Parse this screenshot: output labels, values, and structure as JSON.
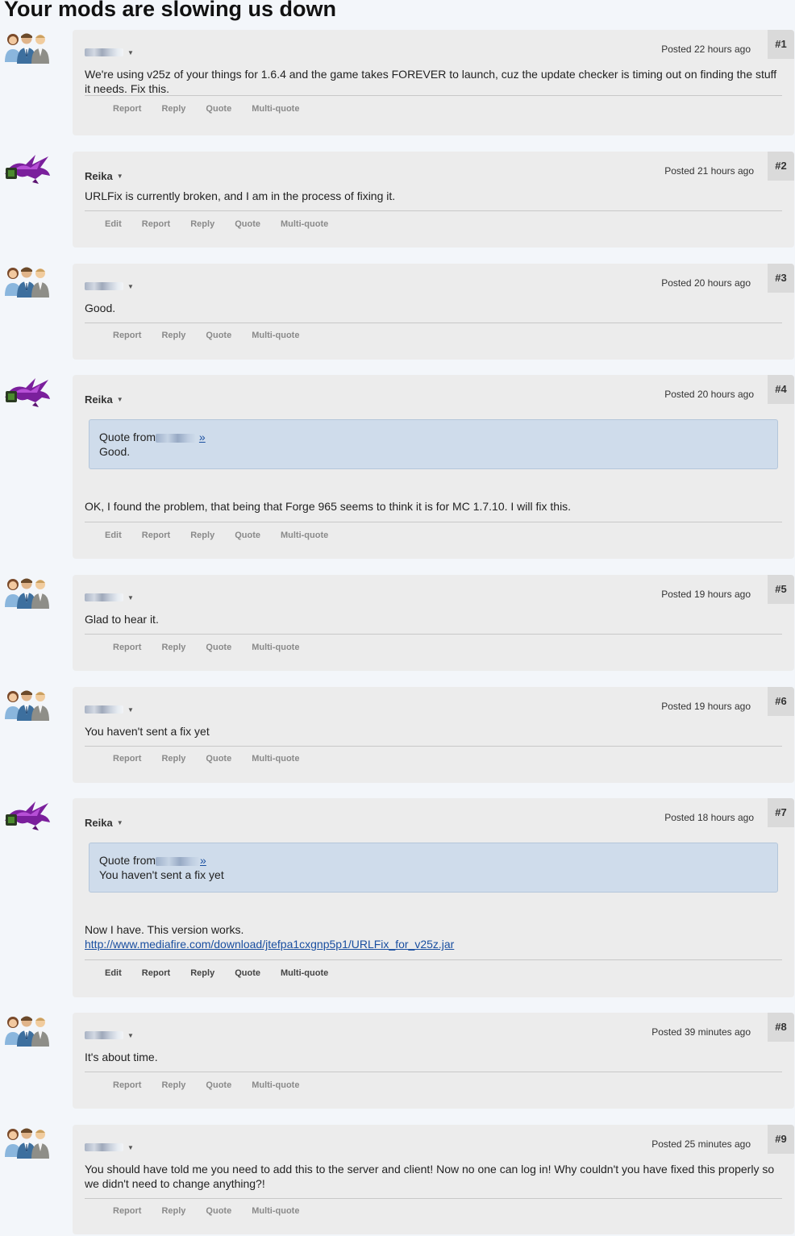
{
  "page_title": "Your mods are slowing us down",
  "actions": {
    "edit": "Edit",
    "report": "Report",
    "reply": "Reply",
    "quote": "Quote",
    "multi_quote": "Multi-quote"
  },
  "quote_prefix": "Quote from",
  "quote_link": "»",
  "posts": [
    {
      "num": "#1",
      "author": "",
      "posted": "Posted 22 hours ago",
      "text": "We're using v25z of your things for 1.6.4 and the game takes FOREVER to launch, cuz the update checker is timing out on finding the stuff it needs. Fix this."
    },
    {
      "num": "#2",
      "author": "Reika",
      "posted": "Posted 21 hours ago",
      "text": "URLFix is currently broken, and I am in the process of fixing it."
    },
    {
      "num": "#3",
      "author": "",
      "posted": "Posted 20 hours ago",
      "text": "Good."
    },
    {
      "num": "#4",
      "author": "Reika",
      "posted": "Posted 20 hours ago",
      "quote_text": "Good.",
      "text": "OK, I found the problem, that being that Forge 965 seems to think it is for MC 1.7.10. I will fix this."
    },
    {
      "num": "#5",
      "author": "",
      "posted": "Posted 19 hours ago",
      "text": "Glad to hear it."
    },
    {
      "num": "#6",
      "author": "",
      "posted": "Posted 19 hours ago",
      "text": "You haven't sent a fix yet"
    },
    {
      "num": "#7",
      "author": "Reika",
      "posted": "Posted 18 hours ago",
      "quote_text": "You haven't sent a fix yet",
      "text": "Now I have. This version works.",
      "link": "http://www.mediafire.com/download/jtefpa1cxgnp5p1/URLFix_for_v25z.jar"
    },
    {
      "num": "#8",
      "author": "",
      "posted": "Posted 39 minutes ago",
      "text": "It's about time."
    },
    {
      "num": "#9",
      "author": "",
      "posted": "Posted 25 minutes ago",
      "text": "You should have told me you need to add this to the server and client! Now no one can log in! Why couldn't you have fixed this properly so we didn't need to change anything?!"
    }
  ]
}
